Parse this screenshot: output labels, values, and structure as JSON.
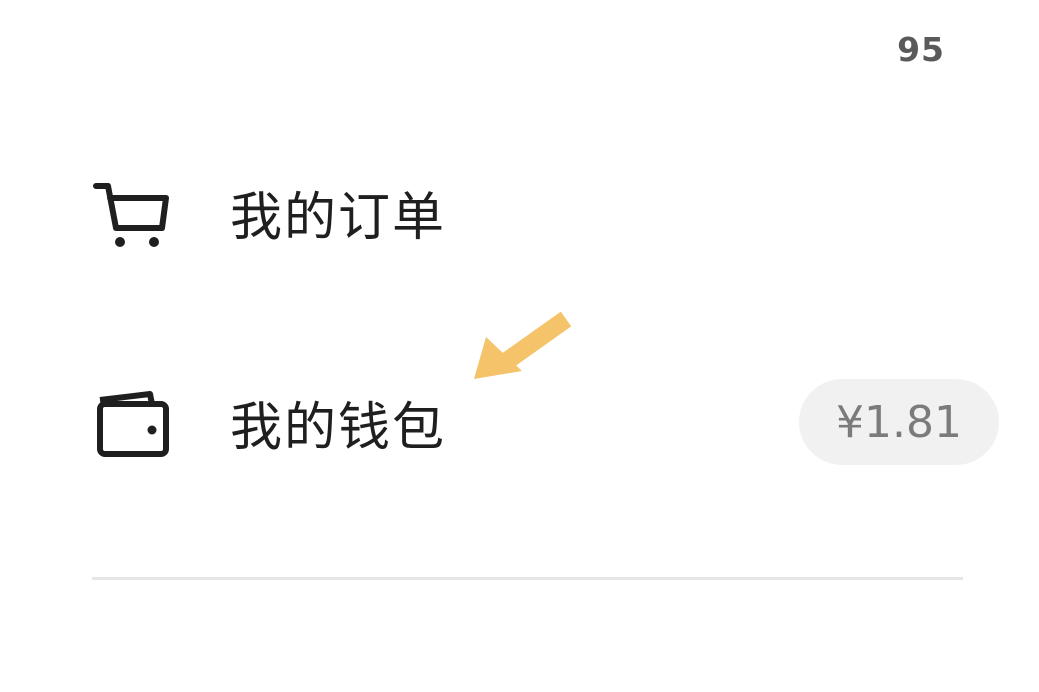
{
  "header": {
    "count": "95"
  },
  "menu": {
    "orders": {
      "label": "我的订单",
      "icon": "cart-icon"
    },
    "wallet": {
      "label": "我的钱包",
      "icon": "wallet-icon",
      "balance": "¥1.81"
    }
  },
  "annotation": {
    "icon": "arrow-pointer-icon",
    "color": "#F4C36A"
  }
}
